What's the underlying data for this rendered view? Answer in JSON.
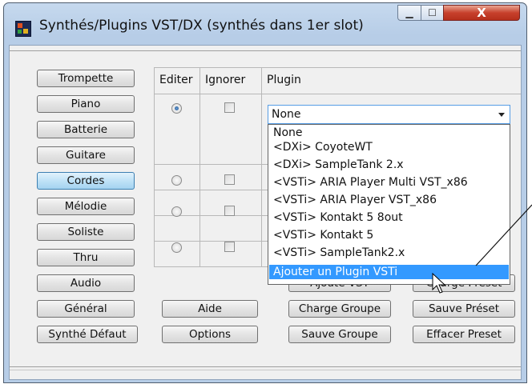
{
  "window": {
    "title": "Synthés/Plugins VST/DX (synthés dans 1er slot)",
    "minimize_glyph": "▁",
    "maximize_glyph": "☐",
    "close_glyph": "X"
  },
  "left_buttons": [
    {
      "label": "Trompette",
      "selected": false
    },
    {
      "label": "Piano",
      "selected": false
    },
    {
      "label": "Batterie",
      "selected": false
    },
    {
      "label": "Guitare",
      "selected": false
    },
    {
      "label": "Cordes",
      "selected": true
    },
    {
      "label": "Mélodie",
      "selected": false
    },
    {
      "label": "Soliste",
      "selected": false
    },
    {
      "label": "Thru",
      "selected": false
    },
    {
      "label": "Audio",
      "selected": false
    },
    {
      "label": "Général",
      "selected": false
    },
    {
      "label": "Synthé Défaut",
      "selected": false
    }
  ],
  "table": {
    "headers": {
      "edit": "Editer",
      "ignore": "Ignorer",
      "plugin": "Plugin"
    },
    "rows": [
      {
        "edit_selected": true,
        "ignore_checked": false,
        "plugin": "None"
      },
      {
        "edit_selected": false,
        "ignore_checked": false
      },
      {
        "edit_selected": false,
        "ignore_checked": false
      },
      {
        "edit_selected": false,
        "ignore_checked": false
      }
    ]
  },
  "plugin_dropdown": {
    "value": "None",
    "options": [
      "None",
      "<DXi> CoyoteWT",
      "<DXi> SampleTank 2.x",
      "<VSTi> ARIA Player Multi VST_x86",
      "<VSTi> ARIA Player VST_x86",
      "<VSTi> Kontakt 5 8out",
      "<VSTi> Kontakt 5",
      "<VSTi> SampleTank2.x",
      "Ajouter un Plugin  VSTi"
    ],
    "highlighted_index": 8
  },
  "bottom_buttons": {
    "aide": "Aide",
    "options": "Options",
    "ajoute_vst": "Ajoute VST",
    "charge_groupe": "Charge Groupe",
    "sauve_groupe": "Sauve Groupe",
    "charge_preset": "Charge Préset",
    "sauve_preset": "Sauve Préset",
    "effacer_preset": "Effacer Preset"
  },
  "colors": {
    "highlight": "#3399ff",
    "selected_button": "#bfe2f7",
    "close_button": "#c7402c"
  }
}
